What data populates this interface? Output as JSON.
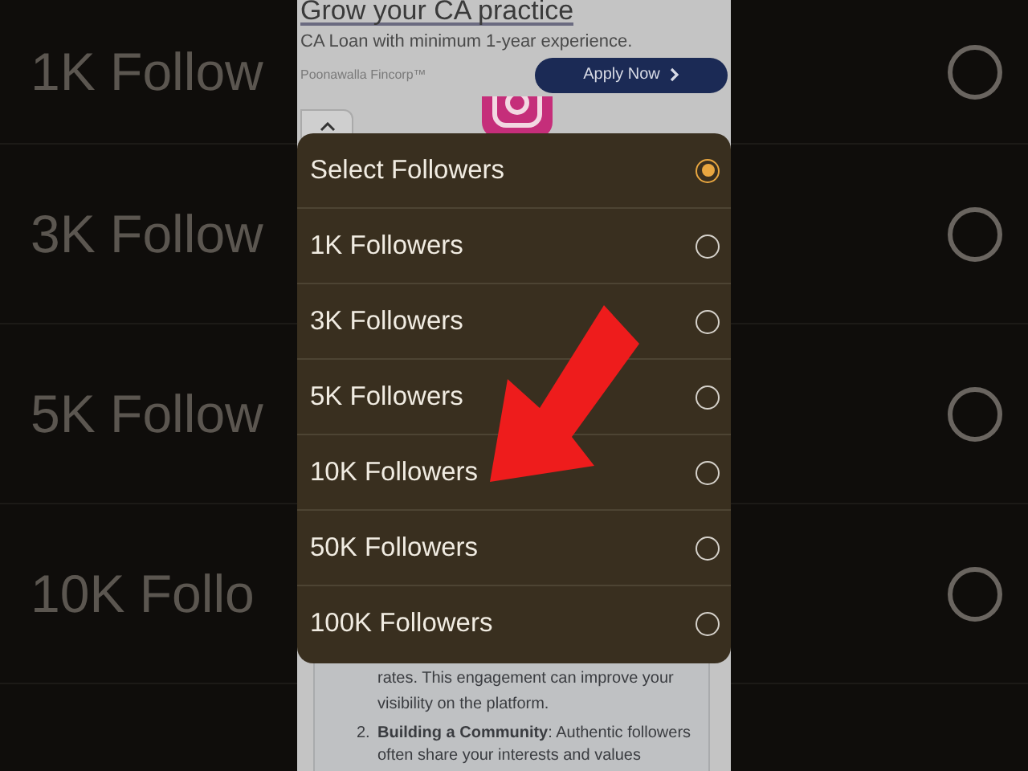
{
  "backdrop": {
    "labels": [
      "1K Follow",
      "3K Follow",
      "5K Follow",
      "10K Follo"
    ]
  },
  "ad": {
    "headline": "Grow your CA practice",
    "subtitle": "CA Loan with minimum 1-year experience.",
    "brand": "Poonawalla Fincorp™",
    "button": "Apply Now"
  },
  "dialog": {
    "options": [
      {
        "label": "Select Followers",
        "selected": true
      },
      {
        "label": "1K Followers",
        "selected": false
      },
      {
        "label": "3K Followers",
        "selected": false
      },
      {
        "label": "5K Followers",
        "selected": false
      },
      {
        "label": "10K Followers",
        "selected": false
      },
      {
        "label": "50K Followers",
        "selected": false
      },
      {
        "label": "100K Followers",
        "selected": false
      }
    ]
  },
  "article": {
    "lines": [
      "rates. This engagement can improve your",
      "visibility on the platform."
    ],
    "list_number": "2.",
    "list_text": "**Building a Community**: Authentic followers",
    "list_continuation": "often share your interests and values"
  }
}
